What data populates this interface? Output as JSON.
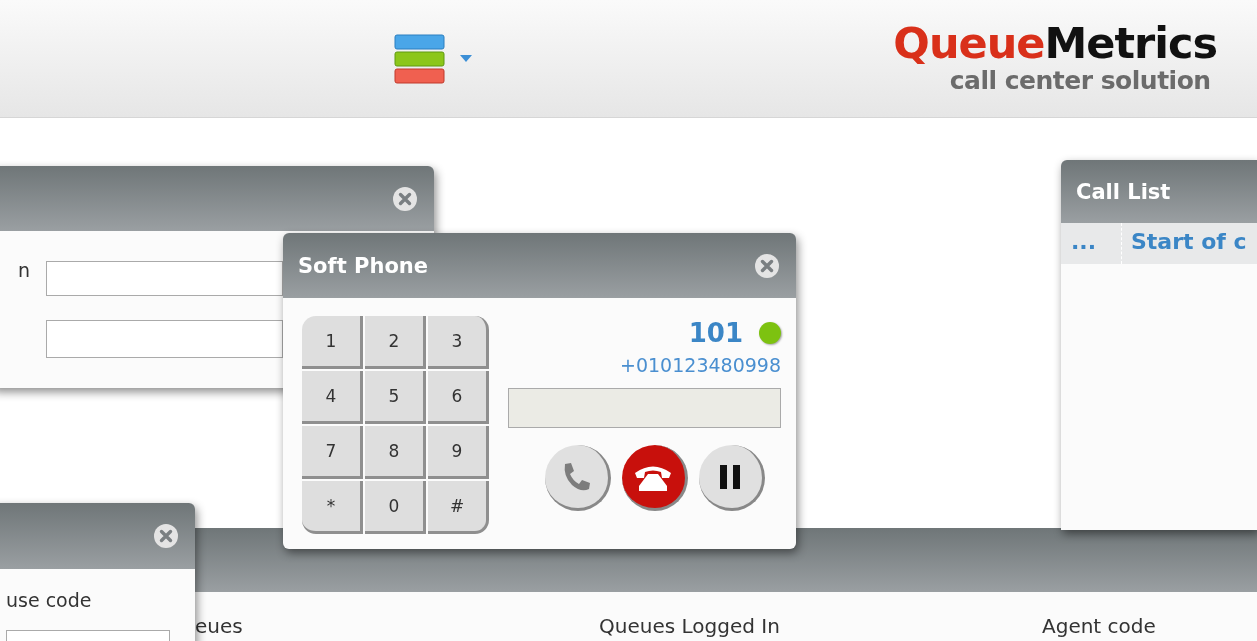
{
  "header": {
    "logo": {
      "brand_first": "Queue",
      "brand_second": "Metrics",
      "tagline": "call center solution"
    }
  },
  "login_panel": {
    "label": "n"
  },
  "call_list": {
    "title": "Call List",
    "columns": [
      "...",
      "Start of c"
    ]
  },
  "agents_table": {
    "columns": [
      "eues",
      "Queues Logged In",
      "Agent code"
    ]
  },
  "pause_panel": {
    "label": "use code"
  },
  "soft_phone": {
    "title": "Soft Phone",
    "keys": [
      "1",
      "2",
      "3",
      "4",
      "5",
      "6",
      "7",
      "8",
      "9",
      "*",
      "0",
      "#"
    ],
    "extension": "101",
    "online": true,
    "number": "+010123480998",
    "buttons": [
      {
        "kind": "call"
      },
      {
        "kind": "hangup"
      },
      {
        "kind": "pause"
      }
    ]
  }
}
